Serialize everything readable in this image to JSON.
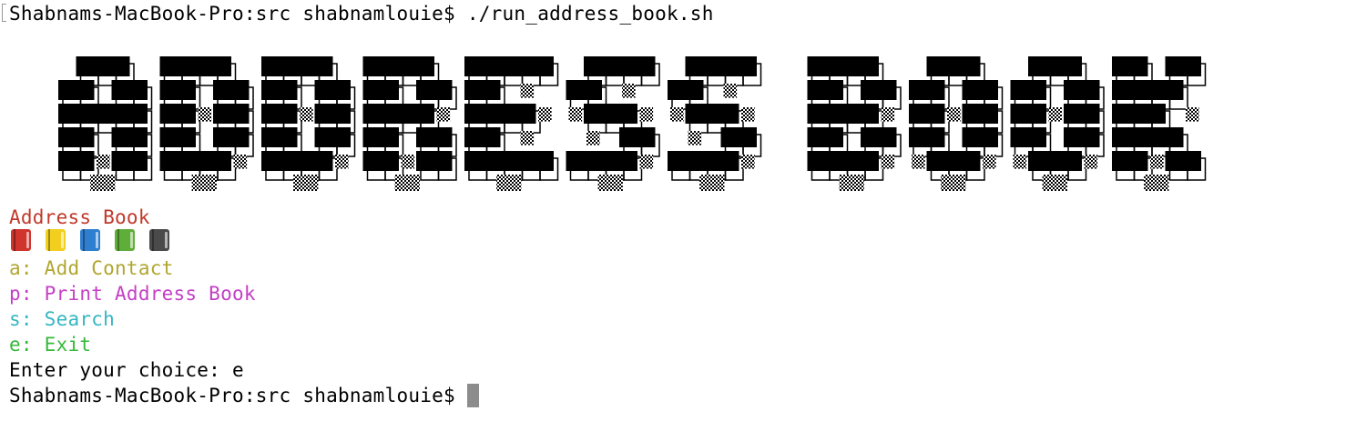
{
  "terminal": {
    "command_line": "Shabnams-MacBook-Pro:src shabnamlouie$ ./run_address_book.sh",
    "banner_text": "ADDRESS BOOK",
    "title": "Address Book",
    "emojis": [
      "red-book-icon",
      "notebook-icon",
      "blue-book-icon",
      "green-book-icon",
      "composition-notebook-icon"
    ],
    "menu": [
      {
        "label": "a: Add Contact",
        "color": "#b0a630"
      },
      {
        "label": "p: Print Address Book",
        "color": "#c440c4"
      },
      {
        "label": "s: Search",
        "color": "#35b6c2"
      },
      {
        "label": "e: Exit",
        "color": "#36b83a"
      }
    ],
    "choice_line": "Enter your choice: e",
    "prompt": "Shabnams-MacBook-Pro:src shabnamlouie$ ",
    "title_color": "#c0392b"
  }
}
